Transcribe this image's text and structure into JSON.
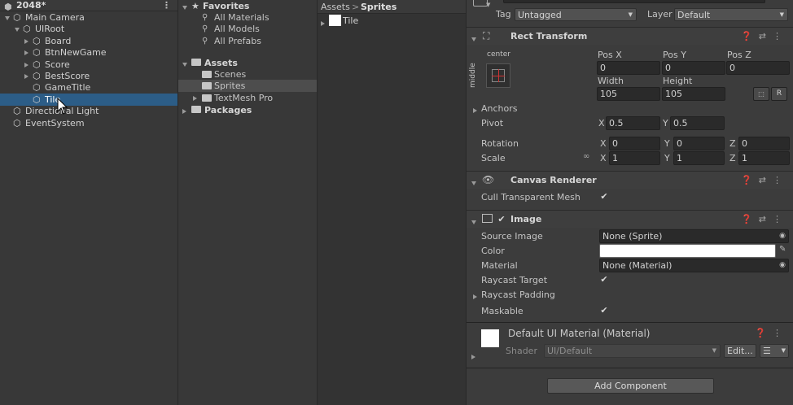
{
  "hierarchy": {
    "scene_name": "2048*",
    "items": [
      {
        "label": "Main Camera",
        "depth": 0,
        "arrow": "down"
      },
      {
        "label": "UIRoot",
        "depth": 1,
        "arrow": "down"
      },
      {
        "label": "Board",
        "depth": 2,
        "arrow": "right"
      },
      {
        "label": "BtnNewGame",
        "depth": 2,
        "arrow": "right"
      },
      {
        "label": "Score",
        "depth": 2,
        "arrow": "right"
      },
      {
        "label": "BestScore",
        "depth": 2,
        "arrow": "right"
      },
      {
        "label": "GameTitle",
        "depth": 2,
        "arrow": ""
      },
      {
        "label": "Tile",
        "depth": 2,
        "arrow": "",
        "selected": true
      },
      {
        "label": "Directional Light",
        "depth": 0,
        "arrow": ""
      },
      {
        "label": "EventSystem",
        "depth": 0,
        "arrow": ""
      }
    ]
  },
  "project": {
    "favorites_label": "Favorites",
    "favorites": [
      "All Materials",
      "All Models",
      "All Prefabs"
    ],
    "assets_label": "Assets",
    "assets": [
      "Scenes",
      "Sprites",
      "TextMesh Pro"
    ],
    "packages_label": "Packages"
  },
  "assets_view": {
    "breadcrumb_root": "Assets",
    "breadcrumb_sep": ">",
    "breadcrumb_current": "Sprites",
    "items": [
      "Tile"
    ]
  },
  "inspector": {
    "tag_label": "Tag",
    "tag_value": "Untagged",
    "layer_label": "Layer",
    "layer_value": "Default",
    "rect_transform": {
      "title": "Rect Transform",
      "anchor_h": "center",
      "anchor_v": "middle",
      "pos_x_label": "Pos X",
      "pos_y_label": "Pos Y",
      "pos_z_label": "Pos Z",
      "pos_x": "0",
      "pos_y": "0",
      "pos_z": "0",
      "width_label": "Width",
      "height_label": "Height",
      "width": "105",
      "height": "105",
      "r_button": "R",
      "anchors_label": "Anchors",
      "pivot_label": "Pivot",
      "pivot_x_label": "X",
      "pivot_x": "0.5",
      "pivot_y_label": "Y",
      "pivot_y": "0.5",
      "rotation_label": "Rotation",
      "rot_x": "0",
      "rot_y": "0",
      "rot_z": "0",
      "scale_label": "Scale",
      "scale_x": "1",
      "scale_y": "1",
      "scale_z": "1",
      "x": "X",
      "y": "Y",
      "z": "Z"
    },
    "canvas_renderer": {
      "title": "Canvas Renderer",
      "cull_label": "Cull Transparent Mesh",
      "cull_checked": true
    },
    "image": {
      "title": "Image",
      "source_label": "Source Image",
      "source_value": "None (Sprite)",
      "color_label": "Color",
      "color_value": "#ffffff",
      "material_label": "Material",
      "material_value": "None (Material)",
      "raycast_target_label": "Raycast Target",
      "raycast_padding_label": "Raycast Padding",
      "maskable_label": "Maskable"
    },
    "material": {
      "title": "Default UI Material (Material)",
      "shader_label": "Shader",
      "shader_value": "UI/Default",
      "edit_label": "Edit..."
    },
    "add_component": "Add Component"
  },
  "colors": {
    "selection": "#2c5d87",
    "panel": "#383838",
    "inspector": "#3c3c3c"
  }
}
